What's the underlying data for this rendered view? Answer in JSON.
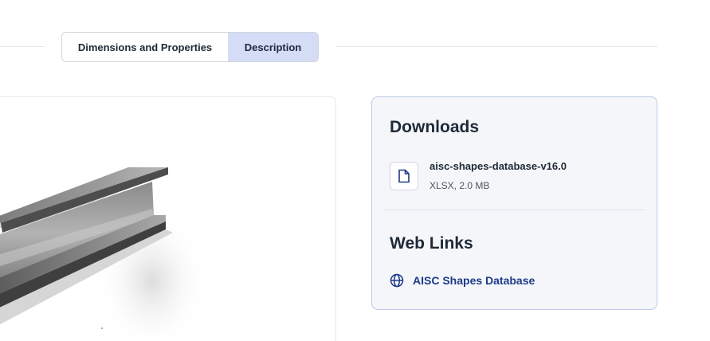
{
  "tabs": {
    "dimensions_label": "Dimensions and Properties",
    "description_label": "Description",
    "active": "Description"
  },
  "image": {
    "subject": "steel I-beam"
  },
  "downloads": {
    "heading": "Downloads",
    "file": {
      "icon": "file-icon",
      "name": "aisc-shapes-database-v16.0",
      "meta": "XLSX, 2.0 MB"
    }
  },
  "web_links": {
    "heading": "Web Links",
    "link": {
      "icon": "globe-icon",
      "label": "AISC Shapes Database"
    }
  },
  "colors": {
    "active_tab_bg": "#d5dcf6",
    "link_color": "#1e3a8a",
    "side_card_bg": "#f4f6f9",
    "side_card_border": "#b9cbe8"
  }
}
